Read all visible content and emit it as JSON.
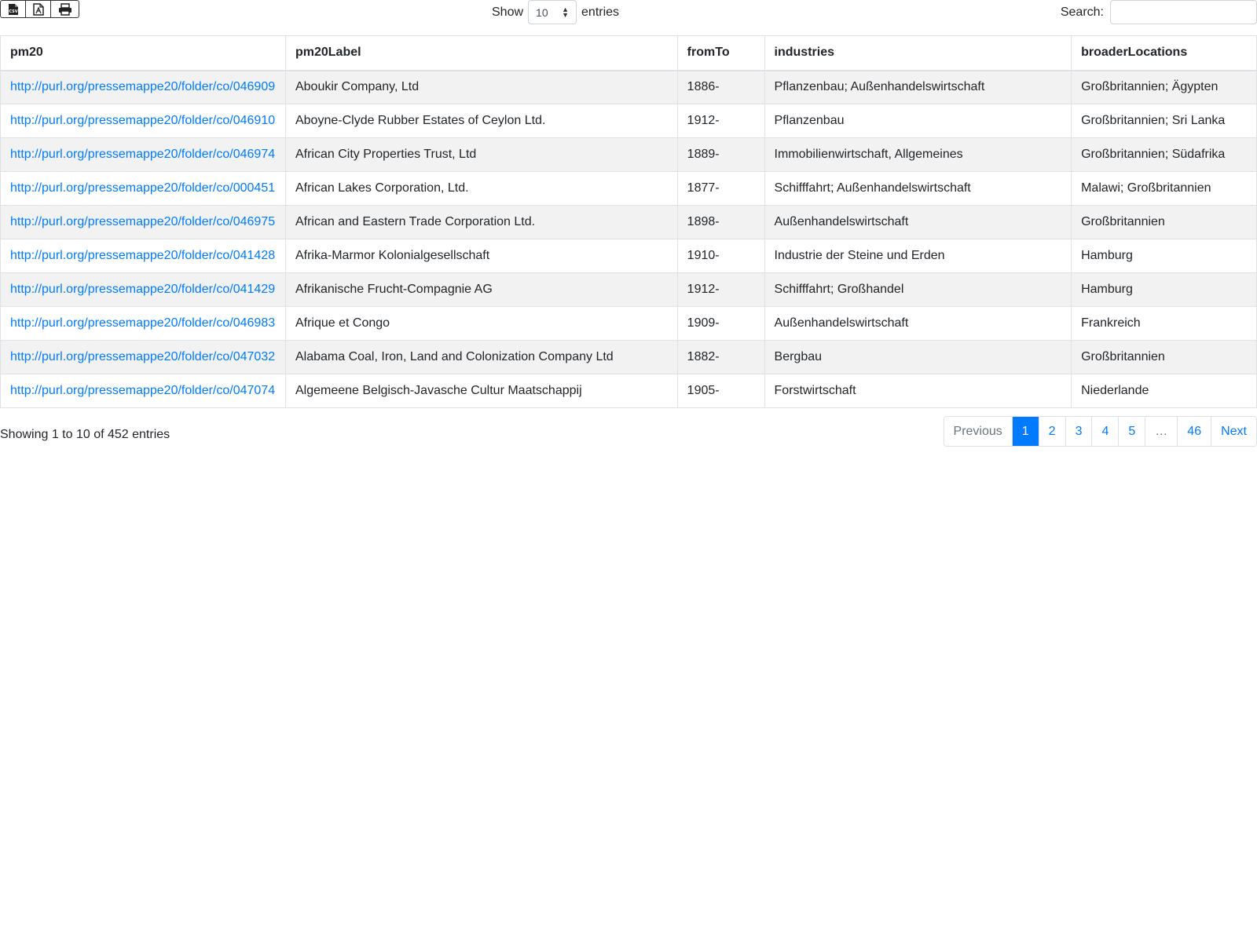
{
  "toolbar": {
    "buttons": [
      {
        "icon": "csv-file-icon"
      },
      {
        "icon": "pdf-file-icon"
      },
      {
        "icon": "print-icon"
      }
    ],
    "show_label": "Show",
    "page_length": "10",
    "entries_label": "entries",
    "search_label": "Search:",
    "search_value": ""
  },
  "table": {
    "columns": [
      "pm20",
      "pm20Label",
      "fromTo",
      "industries",
      "broaderLocations"
    ],
    "rows": [
      [
        "http://purl.org/pressemappe20/folder/co/046909",
        "Aboukir Company, Ltd",
        "1886-",
        "Pflanzenbau; Außenhandelswirtschaft",
        "Großbritannien; Ägypten"
      ],
      [
        "http://purl.org/pressemappe20/folder/co/046910",
        "Aboyne-Clyde Rubber Estates of Ceylon Ltd.",
        "1912-",
        "Pflanzenbau",
        "Großbritannien; Sri Lanka"
      ],
      [
        "http://purl.org/pressemappe20/folder/co/046974",
        "African City Properties Trust, Ltd",
        "1889-",
        "Immobilienwirtschaft, Allgemeines",
        "Großbritannien; Südafrika"
      ],
      [
        "http://purl.org/pressemappe20/folder/co/000451",
        "African Lakes Corporation, Ltd.",
        "1877-",
        "Schifffahrt; Außenhandelswirtschaft",
        "Malawi; Großbritannien"
      ],
      [
        "http://purl.org/pressemappe20/folder/co/046975",
        "African and Eastern Trade Corporation Ltd.",
        "1898-",
        "Außenhandelswirtschaft",
        "Großbritannien"
      ],
      [
        "http://purl.org/pressemappe20/folder/co/041428",
        "Afrika-Marmor Kolonialgesellschaft",
        "1910-",
        "Industrie der Steine und Erden",
        "Hamburg"
      ],
      [
        "http://purl.org/pressemappe20/folder/co/041429",
        "Afrikanische Frucht-Compagnie AG",
        "1912-",
        "Schifffahrt; Großhandel",
        "Hamburg"
      ],
      [
        "http://purl.org/pressemappe20/folder/co/046983",
        "Afrique et Congo",
        "1909-",
        "Außenhandelswirtschaft",
        "Frankreich"
      ],
      [
        "http://purl.org/pressemappe20/folder/co/047032",
        "Alabama Coal, Iron, Land and Colonization Company Ltd",
        "1882-",
        "Bergbau",
        "Großbritannien"
      ],
      [
        "http://purl.org/pressemappe20/folder/co/047074",
        "Algemeene Belgisch-Javasche Cultur Maatschappij",
        "1905-",
        "Forstwirtschaft",
        "Niederlande"
      ]
    ]
  },
  "footer": {
    "info": "Showing 1 to 10 of 452 entries",
    "pagination": [
      "Previous",
      "1",
      "2",
      "3",
      "4",
      "5",
      "…",
      "46",
      "Next"
    ],
    "active_page": "1"
  },
  "colors": {
    "link": "#007bff",
    "active_page_bg": "#007bff",
    "stripe": "#f2f2f2",
    "border": "#dee2e6"
  }
}
